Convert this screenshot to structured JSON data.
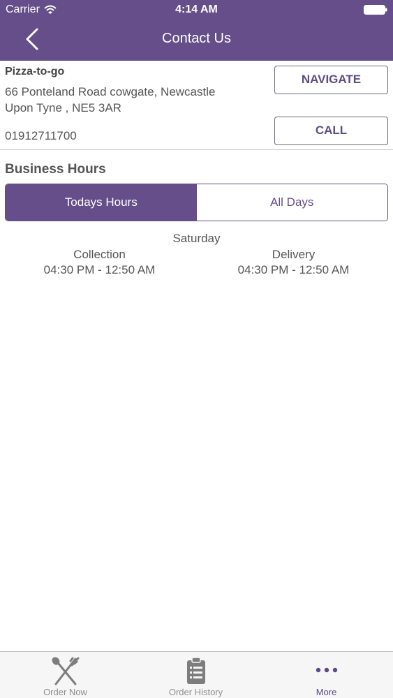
{
  "status_bar": {
    "carrier": "Carrier",
    "time": "4:14 AM"
  },
  "nav": {
    "title": "Contact Us"
  },
  "business": {
    "name": "Pizza-to-go",
    "address_line1": "66 Ponteland Road cowgate, Newcastle",
    "address_line2": "Upon Tyne , NE5 3AR",
    "phone": "01912711700",
    "navigate_label": "NAVIGATE",
    "call_label": "CALL"
  },
  "hours": {
    "heading": "Business Hours",
    "tabs": [
      {
        "label": "Todays Hours",
        "active": true
      },
      {
        "label": "All Days",
        "active": false
      }
    ],
    "day": "Saturday",
    "collection": {
      "label": "Collection",
      "time": "04:30 PM - 12:50 AM"
    },
    "delivery": {
      "label": "Delivery",
      "time": "04:30 PM - 12:50 AM"
    }
  },
  "tab_bar": {
    "items": [
      {
        "label": "Order Now",
        "icon": "fork-spoon-icon"
      },
      {
        "label": "Order History",
        "icon": "clipboard-icon"
      },
      {
        "label": "More",
        "icon": "more-dots-icon"
      }
    ]
  },
  "colors": {
    "primary": "#654e8a",
    "active_tab": "#5b4a85",
    "inactive_tab": "#8e8e8e"
  }
}
